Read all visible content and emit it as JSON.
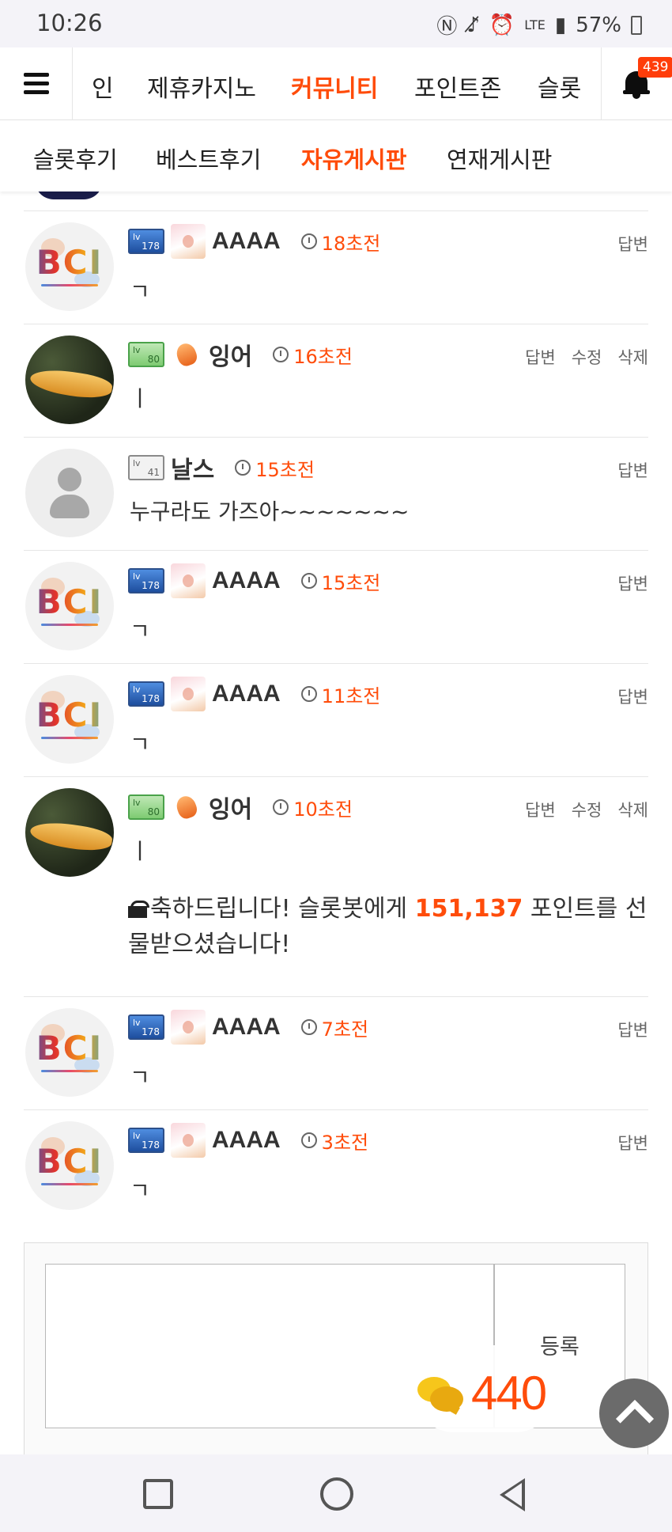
{
  "status_bar": {
    "time": "10:26",
    "icons": [
      "nfc-icon",
      "mute-icon",
      "alarm-icon",
      "lte-icon",
      "signal-icon"
    ],
    "battery": "57%"
  },
  "top_nav": {
    "items": [
      "인",
      "제휴카지노",
      "커뮤니티",
      "포인트존",
      "슬롯"
    ],
    "active": "커뮤니티",
    "notification_count": "439"
  },
  "sub_nav": {
    "items": [
      "슬롯후기",
      "베스트후기",
      "자유게시판",
      "연재게시판"
    ],
    "active": "자유게시판"
  },
  "comments": [
    {
      "avatar": "bci-logo",
      "level": "178",
      "nick": "AAAA",
      "time": "18초전",
      "actions": [
        "답변"
      ],
      "text": "ㄱ"
    },
    {
      "avatar": "koi-fish",
      "level": "80",
      "nick": "잉어",
      "time": "16초전",
      "actions": [
        "답변",
        "수정",
        "삭제"
      ],
      "text": "ㅣ"
    },
    {
      "avatar": "default-person",
      "level": "41",
      "nick": "날스",
      "time": "15초전",
      "actions": [
        "답변"
      ],
      "text": "누구라도 가즈아~~~~~~~"
    },
    {
      "avatar": "bci-logo",
      "level": "178",
      "nick": "AAAA",
      "time": "15초전",
      "actions": [
        "답변"
      ],
      "text": "ㄱ"
    },
    {
      "avatar": "bci-logo",
      "level": "178",
      "nick": "AAAA",
      "time": "11초전",
      "actions": [
        "답변"
      ],
      "text": "ㄱ"
    },
    {
      "avatar": "koi-fish",
      "level": "80",
      "nick": "잉어",
      "time": "10초전",
      "actions": [
        "답변",
        "수정",
        "삭제"
      ],
      "text": "ㅣ",
      "gift": {
        "before": "축하드립니다! 슬롯봇에게 ",
        "points": "151,137",
        "after": " 포인트를 선물받으셨습니다!"
      }
    },
    {
      "avatar": "bci-logo",
      "level": "178",
      "nick": "AAAA",
      "time": "7초전",
      "actions": [
        "답변"
      ],
      "text": "ㄱ"
    },
    {
      "avatar": "bci-logo",
      "level": "178",
      "nick": "AAAA",
      "time": "3초전",
      "actions": [
        "답변"
      ],
      "text": "ㄱ"
    }
  ],
  "write_box": {
    "submit_label": "등록"
  },
  "chat_float": {
    "count": "440"
  },
  "colors": {
    "accent": "#ff4c0a",
    "text": "#333333",
    "muted": "#666666"
  }
}
